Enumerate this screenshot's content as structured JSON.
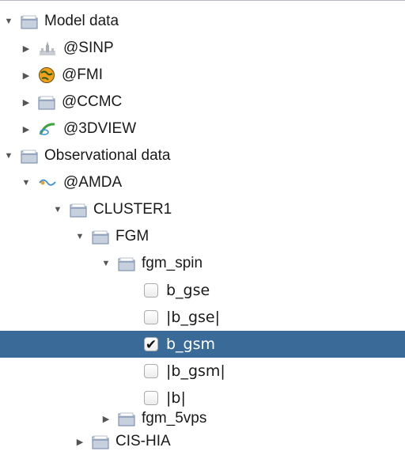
{
  "tree": {
    "model_data": {
      "label": "Model data"
    },
    "sinp": {
      "label": "@SINP"
    },
    "fmi": {
      "label": "@FMI"
    },
    "ccmc": {
      "label": "@CCMC"
    },
    "threedview": {
      "label": "@3DVIEW"
    },
    "observational_data": {
      "label": "Observational data"
    },
    "amda": {
      "label": "@AMDA"
    },
    "cluster1": {
      "label": "CLUSTER1"
    },
    "fgm": {
      "label": "FGM"
    },
    "fgm_spin": {
      "label": "fgm_spin"
    },
    "params": [
      {
        "label": "b_gse",
        "checked": false
      },
      {
        "label": "|b_gse|",
        "checked": false
      },
      {
        "label": "b_gsm",
        "checked": true
      },
      {
        "label": "|b_gsm|",
        "checked": false
      },
      {
        "label": "|b|",
        "checked": false
      }
    ],
    "fgm_5vps": {
      "label": "fgm_5vps"
    },
    "cis_hia": {
      "label": "CIS-HIA"
    }
  },
  "glyphs": {
    "expanded": "▼",
    "collapsed": "▶",
    "check": "✔"
  },
  "colors": {
    "selection": "#3a6b98",
    "folder": "#6d84a6"
  }
}
